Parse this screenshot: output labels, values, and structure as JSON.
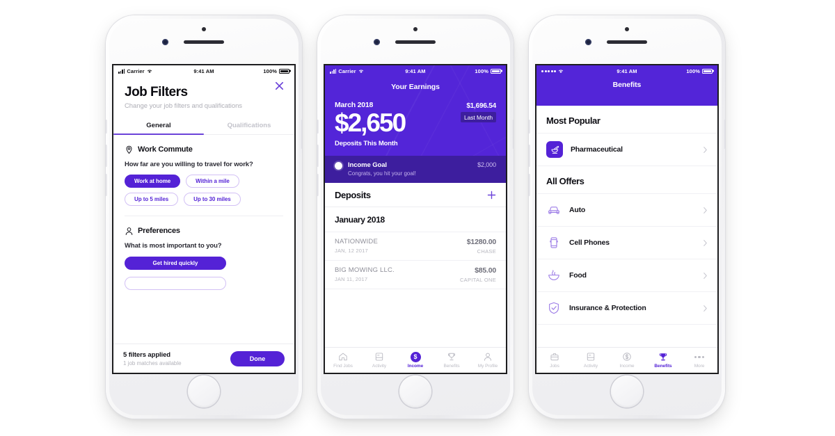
{
  "meta": {
    "accent_purple": "#5422d6",
    "header_purple": "#5325d8",
    "deep_purple": "#3d1e9e",
    "background": "#ffffff"
  },
  "phone1": {
    "status": {
      "carrier": "Carrier",
      "time": "9:41 AM",
      "battery": "100%",
      "signal_style": "bars"
    },
    "title": "Job Filters",
    "subtitle": "Change your job filters and qualifications",
    "close_icon": "close-icon",
    "tabs": [
      {
        "label": "General",
        "active": true
      },
      {
        "label": "Qualifications",
        "active": false
      }
    ],
    "sections": [
      {
        "icon": "location-pin-icon",
        "title": "Work Commute",
        "question": "How far are you willing to travel for work?",
        "chips": [
          {
            "label": "Work at home",
            "selected": true
          },
          {
            "label": "Within a mile",
            "selected": false
          },
          {
            "label": "Up to 5 miles",
            "selected": false
          },
          {
            "label": "Up to 30 miles",
            "selected": false
          }
        ]
      },
      {
        "icon": "person-icon",
        "title": "Preferences",
        "question": "What is most important to you?",
        "options": [
          {
            "label": "Get hired quickly",
            "selected": true
          },
          {
            "label": "",
            "selected": false
          }
        ]
      }
    ],
    "footer": {
      "applied": "5 filters applied",
      "matches": "1 job matches available",
      "done_label": "Done"
    }
  },
  "phone2": {
    "status": {
      "carrier": "Carrier",
      "time": "9:41 AM",
      "battery": "100%",
      "signal_style": "bars"
    },
    "nav_title": "Your Earnings",
    "month": "March 2018",
    "amount": "$2,650",
    "amount_caption": "Deposits This Month",
    "last_month_amount": "$1,696.54",
    "last_month_label": "Last Month",
    "goal": {
      "title": "Income Goal",
      "amount": "$2,000",
      "subtitle": "Congrats, you hit your goal!"
    },
    "deposits": {
      "header": "Deposits",
      "add_icon": "plus-icon",
      "month_group": "January 2018",
      "rows": [
        {
          "name": "NATIONWIDE",
          "date": "JAN, 12 2017",
          "amount": "$1280.00",
          "bank": "CHASE"
        },
        {
          "name": "BIG MOWING LLC.",
          "date": "JAN 11, 2017",
          "amount": "$85.00",
          "bank": "CAPITAL ONE"
        }
      ]
    },
    "tabbar": [
      {
        "label": "Find Jobs",
        "icon": "home-icon",
        "active": false
      },
      {
        "label": "Activity",
        "icon": "activity-icon",
        "active": false
      },
      {
        "label": "Income",
        "icon": "dollar-coin-icon",
        "active": true
      },
      {
        "label": "Benefits",
        "icon": "trophy-icon",
        "active": false
      },
      {
        "label": "My Profile",
        "icon": "person-icon",
        "active": false
      }
    ]
  },
  "phone3": {
    "status": {
      "carrier": "",
      "time": "9:41 AM",
      "battery": "100%",
      "signal_style": "dots"
    },
    "nav_title": "Benefits",
    "groups": [
      {
        "title": "Most Popular",
        "rows": [
          {
            "label": "Pharmaceutical",
            "icon": "mortar-pestle-icon",
            "style": "filled"
          }
        ]
      },
      {
        "title": "All Offers",
        "rows": [
          {
            "label": "Auto",
            "icon": "car-icon",
            "style": "line"
          },
          {
            "label": "Cell Phones",
            "icon": "phone-icon",
            "style": "line"
          },
          {
            "label": "Food",
            "icon": "bowl-icon",
            "style": "line"
          },
          {
            "label": "Insurance & Protection",
            "icon": "shield-check-icon",
            "style": "line"
          }
        ]
      }
    ],
    "tabbar": [
      {
        "label": "Jobs",
        "icon": "briefcase-icon",
        "active": false
      },
      {
        "label": "Activity",
        "icon": "activity-icon",
        "active": false
      },
      {
        "label": "Income",
        "icon": "dollar-circle-icon",
        "active": false
      },
      {
        "label": "Benefits",
        "icon": "trophy-icon",
        "active": true
      },
      {
        "label": "More",
        "icon": "ellipsis-icon",
        "active": false
      }
    ]
  }
}
